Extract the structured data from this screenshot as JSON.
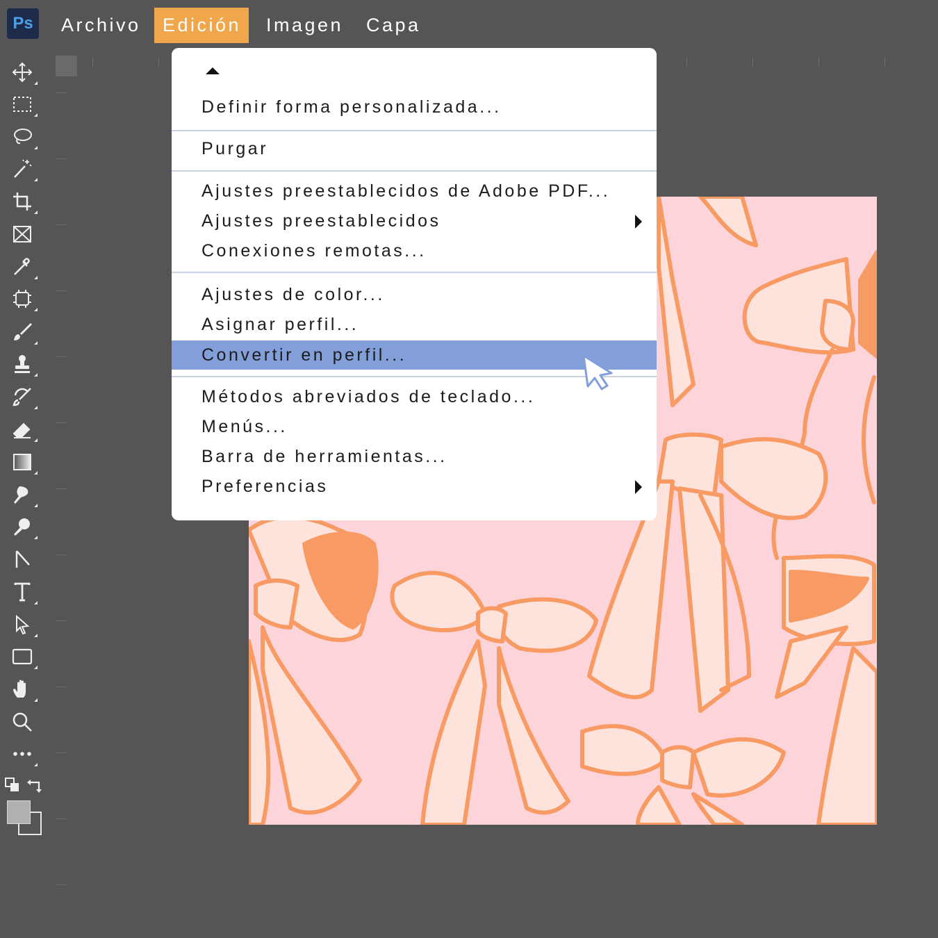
{
  "app": {
    "logo_text": "Ps"
  },
  "menubar": {
    "items": [
      {
        "label": "Archivo"
      },
      {
        "label": "Edición",
        "active": true
      },
      {
        "label": "Imagen"
      },
      {
        "label": "Capa"
      }
    ]
  },
  "edit_menu": {
    "items": [
      {
        "label": "Definir forma personalizada..."
      },
      {
        "label": "Purgar"
      },
      {
        "label": "Ajustes preestablecidos de Adobe PDF..."
      },
      {
        "label": "Ajustes preestablecidos",
        "submenu": true
      },
      {
        "label": "Conexiones remotas..."
      },
      {
        "label": "Ajustes de color..."
      },
      {
        "label": "Asignar perfil..."
      },
      {
        "label": "Convertir en perfil...",
        "highlighted": true
      },
      {
        "label": "Métodos abreviados de teclado..."
      },
      {
        "label": "Menús..."
      },
      {
        "label": "Barra de herramientas..."
      },
      {
        "label": "Preferencias",
        "submenu": true
      }
    ]
  },
  "toolbar": {
    "tools": [
      "move-tool-icon",
      "marquee-tool-icon",
      "lasso-tool-icon",
      "magic-wand-tool-icon",
      "crop-tool-icon",
      "frame-tool-icon",
      "eyedropper-tool-icon",
      "spot-healing-tool-icon",
      "brush-tool-icon",
      "clone-stamp-tool-icon",
      "history-brush-tool-icon",
      "eraser-tool-icon",
      "gradient-tool-icon",
      "smudge-tool-icon",
      "dodge-tool-icon",
      "pen-tool-icon",
      "type-tool-icon",
      "path-selection-tool-icon",
      "rectangle-tool-icon",
      "hand-tool-icon",
      "zoom-tool-icon",
      "more-tools-icon"
    ]
  },
  "colors": {
    "ui_background": "#555555",
    "active_menu": "#f0a64a",
    "highlight_row": "#839fda",
    "canvas_pink": "#fdd4da",
    "bow_orange": "#f79a63",
    "bow_cream": "#fde3dc"
  }
}
